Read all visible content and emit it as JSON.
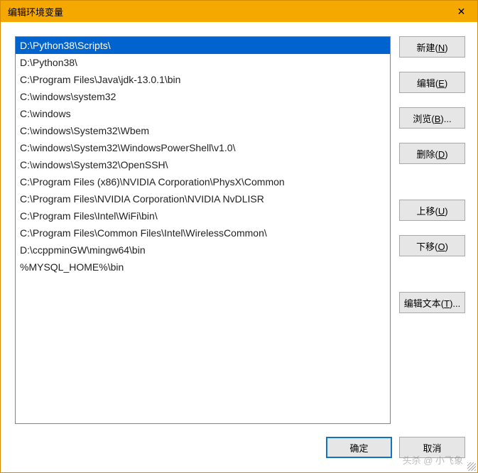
{
  "titlebar": {
    "title": "编辑环境变量",
    "close_glyph": "✕"
  },
  "list": {
    "items": [
      "D:\\Python38\\Scripts\\",
      "D:\\Python38\\",
      "C:\\Program Files\\Java\\jdk-13.0.1\\bin",
      "C:\\windows\\system32",
      "C:\\windows",
      "C:\\windows\\System32\\Wbem",
      "C:\\windows\\System32\\WindowsPowerShell\\v1.0\\",
      "C:\\windows\\System32\\OpenSSH\\",
      "C:\\Program Files (x86)\\NVIDIA Corporation\\PhysX\\Common",
      "C:\\Program Files\\NVIDIA Corporation\\NVIDIA NvDLISR",
      "C:\\Program Files\\Intel\\WiFi\\bin\\",
      "C:\\Program Files\\Common Files\\Intel\\WirelessCommon\\",
      "D:\\ccppminGW\\mingw64\\bin",
      "%MYSQL_HOME%\\bin"
    ],
    "selected_index": 0
  },
  "buttons": {
    "new": {
      "label": "新建",
      "key": "N"
    },
    "edit": {
      "label": "编辑",
      "key": "E"
    },
    "browse": {
      "label": "浏览",
      "key": "B",
      "ellipsis": "..."
    },
    "delete": {
      "label": "删除",
      "key": "D"
    },
    "moveup": {
      "label": "上移",
      "key": "U"
    },
    "movedown": {
      "label": "下移",
      "key": "O"
    },
    "edittext": {
      "label": "编辑文本",
      "key": "T",
      "ellipsis": "..."
    }
  },
  "footer": {
    "ok": "确定",
    "cancel": "取消"
  },
  "watermark": "头杀 @ 小飞象"
}
